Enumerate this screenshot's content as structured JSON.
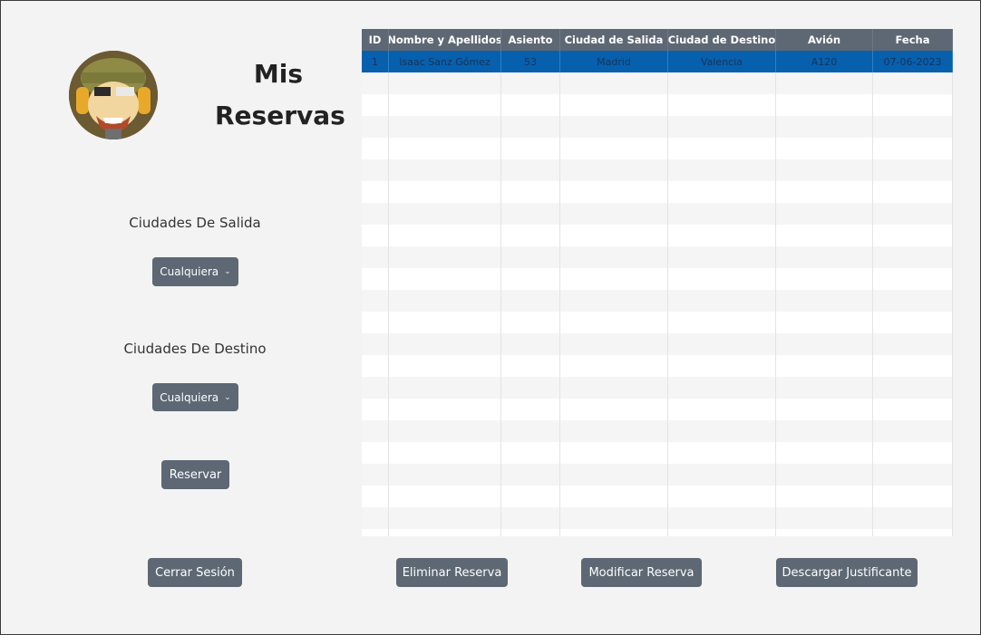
{
  "page": {
    "title": "Mis Reservas"
  },
  "filters": {
    "departure_label": "Ciudades De Salida",
    "departure_value": "Cualquiera",
    "destination_label": "Ciudades De Destino",
    "destination_value": "Cualquiera",
    "reserve_button": "Reservar"
  },
  "table": {
    "columns": [
      "ID",
      "Nombre y Apellidos",
      "Asiento",
      "Ciudad de Salida",
      "Ciudad de Destino",
      "Avión",
      "Fecha"
    ],
    "rows": [
      [
        "1",
        "Isaac Sanz Gómez",
        "53",
        "Madrid",
        "Valencia",
        "A120",
        "07-06-2023"
      ]
    ],
    "selected_row": 0
  },
  "actions": {
    "logout": "Cerrar Sesión",
    "delete": "Eliminar Reserva",
    "modify": "Modificar Reserva",
    "download": "Descargar Justificante"
  },
  "colors": {
    "button_bg": "#5d6874",
    "selected_row": "#0660ad",
    "background": "#f3f3f3"
  }
}
